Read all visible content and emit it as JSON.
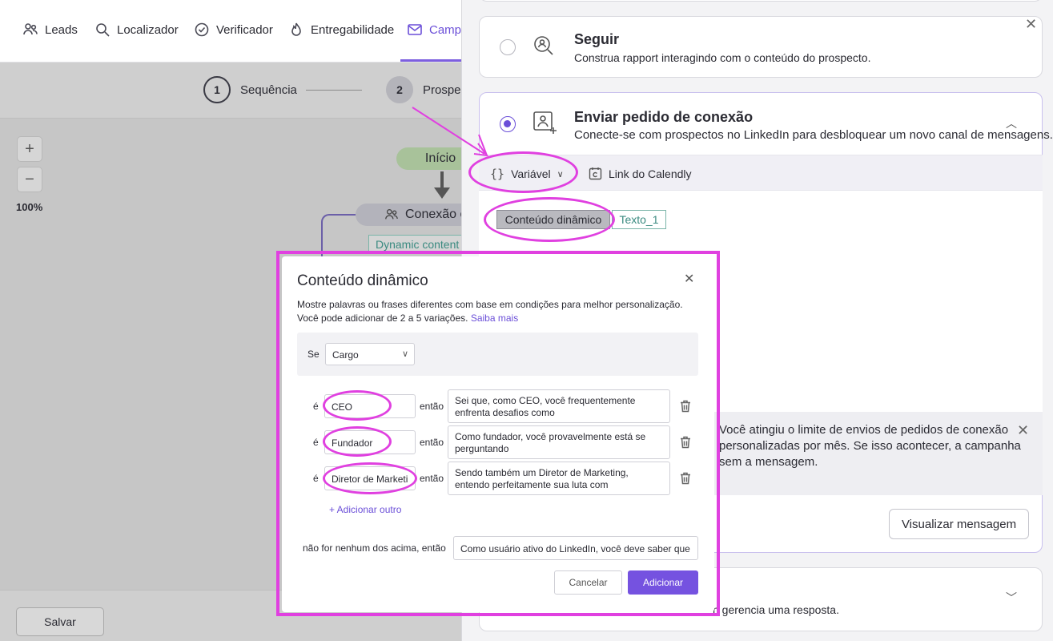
{
  "nav": {
    "items": [
      {
        "label": "Leads",
        "icon": "users-icon"
      },
      {
        "label": "Localizador",
        "icon": "search-icon"
      },
      {
        "label": "Verificador",
        "icon": "check-circle-icon"
      },
      {
        "label": "Entregabilidade",
        "icon": "flame-icon"
      },
      {
        "label": "Campa",
        "icon": "mail-icon"
      }
    ]
  },
  "steps": [
    {
      "number": "1",
      "label": "Sequência"
    },
    {
      "number": "2",
      "label": "Prospe"
    }
  ],
  "canvas": {
    "zoom_in": "+",
    "zoom_out": "−",
    "zoom_level": "100%",
    "start_node": "Início",
    "connection_node": "Conexão c",
    "dynamic_chip": "Dynamic content",
    "save_label": "Salvar"
  },
  "panel": {
    "follow": {
      "title": "Seguir",
      "subtitle": "Construa rapport interagindo com o conteúdo do prospecto."
    },
    "connect": {
      "title": "Enviar pedido de conexão",
      "subtitle": "Conecte-se com prospectos no LinkedIn para desbloquear um novo canal de mensagens."
    },
    "toolbar": {
      "variable_label": "Variável",
      "calendly_label": "Link do Calendly"
    },
    "editor": {
      "dynamic_chip": "Conteúdo dinâmico",
      "text_chip": "Texto_1"
    },
    "warning": "Você atingiu o limite de envios de pedidos de conexão personalizadas por mês. Se isso acontecer, a campanha sem a mensagem.",
    "preview_label": "Visualizar mensagem",
    "bottom_card_text": "n gerencia uma resposta."
  },
  "modal": {
    "title": "Conteúdo dinâmico",
    "description": "Mostre palavras ou frases diferentes com base em condições para melhor personalização. Você pode adicionar de 2 a 5 variações.",
    "learn_more": "Saiba mais",
    "if_label": "Se",
    "condition_field": "Cargo",
    "is_label": "é",
    "then_label": "então",
    "variations": [
      {
        "value": "CEO",
        "output": "Sei que, como CEO, você frequentemente enfrenta desafios como"
      },
      {
        "value": "Fundador",
        "output": "Como fundador, você provavelmente está se perguntando"
      },
      {
        "value": "Diretor de Marketi",
        "output": "Sendo também um Diretor de Marketing, entendo perfeitamente sua luta com"
      }
    ],
    "add_other": "+ Adicionar outro",
    "else_label": "não for nenhum dos acima, então",
    "else_value": "Como usuário ativo do LinkedIn, você deve saber que",
    "cancel_label": "Cancelar",
    "add_label": "Adicionar"
  },
  "colors": {
    "accent": "#6b4fd8",
    "annotation": "#e040e0",
    "primary_button": "#7552e0"
  }
}
